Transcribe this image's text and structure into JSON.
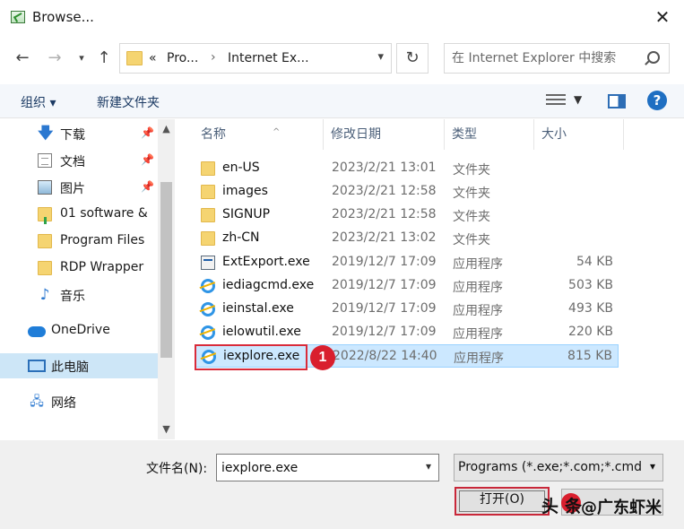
{
  "window": {
    "title": "Browse...",
    "close_glyph": "✕"
  },
  "address": {
    "overflow": "«",
    "segment1": "Pro...",
    "segment2": "Internet Ex...",
    "separator": "›",
    "search_placeholder": "在 Internet Explorer 中搜索"
  },
  "toolbar": {
    "organize_label": "组织 ▾",
    "new_folder_label": "新建文件夹",
    "help_glyph": "?"
  },
  "sidebar": {
    "items": [
      {
        "label": "下载",
        "icon": "download-icon"
      },
      {
        "label": "文档",
        "icon": "document-icon"
      },
      {
        "label": "图片",
        "icon": "pictures-icon"
      },
      {
        "label": "01 software &",
        "icon": "folder-icon"
      },
      {
        "label": "Program Files",
        "icon": "folder-icon"
      },
      {
        "label": "RDP Wrapper",
        "icon": "folder-icon"
      },
      {
        "label": "音乐",
        "icon": "music-icon"
      },
      {
        "label": "OneDrive",
        "icon": "onedrive-icon"
      },
      {
        "label": "此电脑",
        "icon": "this-pc-icon"
      },
      {
        "label": "网络",
        "icon": "network-icon"
      }
    ]
  },
  "columns": {
    "name": "名称",
    "date": "修改日期",
    "type": "类型",
    "size": "大小"
  },
  "files": [
    {
      "name": "en-US",
      "date": "2023/2/21 13:01",
      "type": "文件夹",
      "size": "",
      "icon": "folder-icon"
    },
    {
      "name": "images",
      "date": "2023/2/21 12:58",
      "type": "文件夹",
      "size": "",
      "icon": "folder-icon"
    },
    {
      "name": "SIGNUP",
      "date": "2023/2/21 12:58",
      "type": "文件夹",
      "size": "",
      "icon": "folder-icon"
    },
    {
      "name": "zh-CN",
      "date": "2023/2/21 13:02",
      "type": "文件夹",
      "size": "",
      "icon": "folder-icon"
    },
    {
      "name": "ExtExport.exe",
      "date": "2019/12/7 17:09",
      "type": "应用程序",
      "size": "54 KB",
      "icon": "exe-icon"
    },
    {
      "name": "iediagcmd.exe",
      "date": "2019/12/7 17:09",
      "type": "应用程序",
      "size": "503 KB",
      "icon": "ie-icon"
    },
    {
      "name": "ieinstal.exe",
      "date": "2019/12/7 17:09",
      "type": "应用程序",
      "size": "493 KB",
      "icon": "ie-icon"
    },
    {
      "name": "ielowutil.exe",
      "date": "2019/12/7 17:09",
      "type": "应用程序",
      "size": "220 KB",
      "icon": "ie-icon"
    },
    {
      "name": "iexplore.exe",
      "date": "2022/8/22 14:40",
      "type": "应用程序",
      "size": "815 KB",
      "icon": "ie-icon",
      "selected": true
    }
  ],
  "annotation": {
    "callout_number": "1"
  },
  "bottom": {
    "filename_label": "文件名(N):",
    "filename_value": "iexplore.exe",
    "filetype_value": "Programs (*.exe;*.com;*.cmd",
    "open_label": "打开(O)"
  },
  "watermark": {
    "part1": "头",
    "part2": "条",
    "part3": "@广东虾米"
  },
  "colors": {
    "selection": "#cce8ff",
    "annotation_red": "#d91f2e",
    "accent_blue": "#1f6fc2"
  }
}
